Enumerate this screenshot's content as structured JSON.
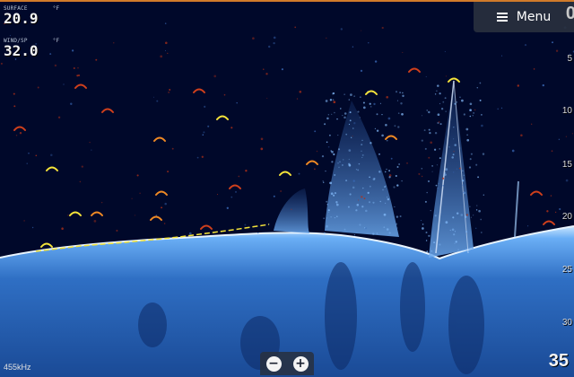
{
  "readouts": {
    "temperature": {
      "label": "SURFACE",
      "unit_mark": "°F",
      "value": "20.9"
    },
    "wind": {
      "label": "WIND/SP",
      "unit_mark": "°F",
      "value": "32.0"
    }
  },
  "menu": {
    "label": "Menu",
    "icon": "hamburger-icon"
  },
  "depth_scale": {
    "top_value": "0",
    "ticks": [
      "5",
      "10",
      "15",
      "20",
      "25",
      "30"
    ]
  },
  "range": {
    "value": "35"
  },
  "frequency": {
    "label": "455kHz"
  },
  "zoom": {
    "zoom_out_label": "−",
    "zoom_in_label": "+"
  },
  "colors": {
    "background": "#00082a",
    "bottom_return": "#3f7fd6",
    "fish_arch_strong": "#f5e43a",
    "fish_arch_medium": "#f08a24",
    "fish_arch_weak": "#d0401c",
    "accent_line": "#d07a2a"
  }
}
